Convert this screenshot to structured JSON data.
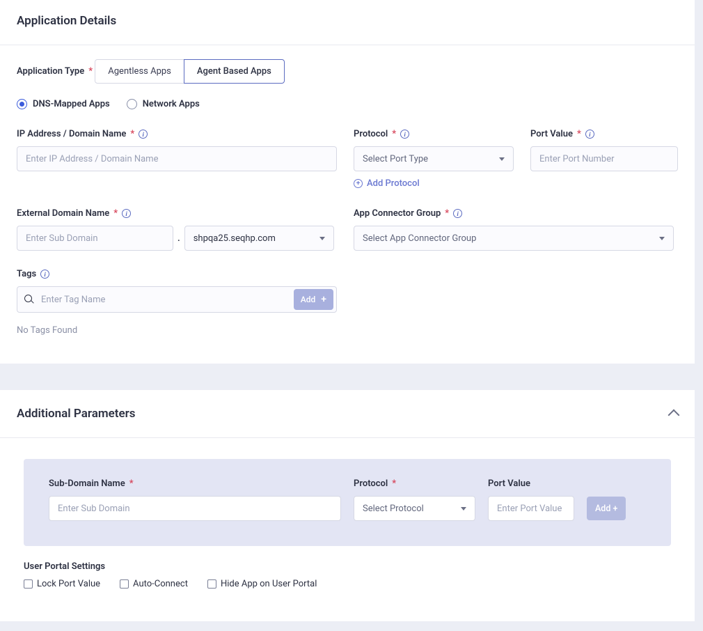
{
  "section1": {
    "title": "Application Details",
    "appTypeLabel": "Application Type",
    "toggle": {
      "agentless": "Agentless Apps",
      "agentBased": "Agent Based Apps"
    },
    "radios": {
      "dnsMapped": "DNS-Mapped Apps",
      "network": "Network Apps"
    },
    "ip": {
      "label": "IP Address / Domain Name",
      "placeholder": "Enter IP Address / Domain Name"
    },
    "protocol": {
      "label": "Protocol",
      "placeholder": "Select Port Type",
      "addLink": "Add Protocol"
    },
    "port": {
      "label": "Port Value",
      "placeholder": "Enter Port Number"
    },
    "extDomain": {
      "label": "External Domain Name",
      "subPlaceholder": "Enter Sub Domain",
      "domainSelected": "shpqa25.seqhp.com"
    },
    "connectorGroup": {
      "label": "App Connector Group",
      "placeholder": "Select App Connector Group"
    },
    "tags": {
      "label": "Tags",
      "placeholder": "Enter Tag Name",
      "addBtn": "Add",
      "empty": "No Tags Found"
    }
  },
  "section2": {
    "title": "Additional Parameters",
    "subDomain": {
      "label": "Sub-Domain Name",
      "placeholder": "Enter Sub Domain"
    },
    "protocol": {
      "label": "Protocol",
      "placeholder": "Select Protocol"
    },
    "port": {
      "label": "Port Value",
      "placeholder": "Enter Port Value"
    },
    "addBtn": "Add +",
    "ups": {
      "title": "User Portal Settings",
      "lock": "Lock Port Value",
      "auto": "Auto-Connect",
      "hide": "Hide App on User Portal"
    }
  }
}
